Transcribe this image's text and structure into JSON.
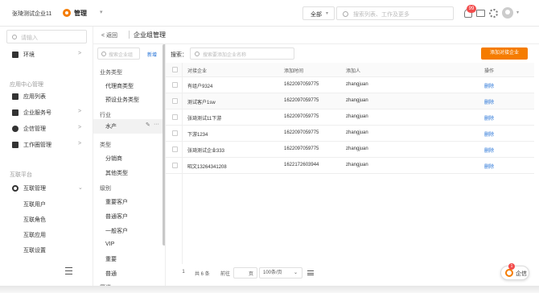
{
  "topbar": {
    "org_name": "张琦测试企业11",
    "module": "管理",
    "module_caret": "▾",
    "scope": "全部",
    "scope_caret": "▾",
    "search_placeholder": "搜索列表、工作及更多",
    "notification_count": "99",
    "avatar_caret": "▾"
  },
  "sidebar": {
    "search_placeholder": "请输入",
    "top_items": [
      {
        "label": "环境",
        "arrow": ">"
      }
    ],
    "section_app": "应用中心管理",
    "app_items": [
      {
        "label": "应用列表",
        "arrow": ""
      },
      {
        "label": "企业服务号",
        "arrow": ">"
      },
      {
        "label": "企信管理",
        "arrow": ">"
      },
      {
        "label": "工作圈管理",
        "arrow": ">"
      }
    ],
    "section_link": "互联平台",
    "link_group": {
      "label": "互联管理",
      "arrow": "⌄"
    },
    "link_subitems": [
      "互联用户",
      "互联角色",
      "互联应用",
      "互联设置"
    ]
  },
  "breadcrumb": {
    "back": "< 返回",
    "title": "企业组管理"
  },
  "category_panel": {
    "search_placeholder": "搜索企业组",
    "new_label": "新增",
    "groups": [
      {
        "title": "业务类型",
        "items": [
          "代理商类型",
          "预设业务类型"
        ]
      },
      {
        "title": "行业",
        "items": [
          "水产"
        ]
      },
      {
        "title": "类型",
        "items": [
          "分销商",
          "其他类型"
        ]
      },
      {
        "title": "级别",
        "items": [
          "重要客户",
          "普通客户",
          "一般客户",
          "VIP",
          "重要",
          "普通"
        ]
      },
      {
        "title": "渠道",
        "items": []
      }
    ],
    "selected": "水产",
    "edit_icon": "✎",
    "more_icon": "···"
  },
  "data_area": {
    "filter_label": "搜索：",
    "filter_placeholder": "搜索要添加企业名称",
    "add_button": "添加对接企业",
    "columns": [
      "对接企业",
      "添加时间",
      "添加人",
      "操作"
    ],
    "rows": [
      {
        "company": "有组户9324",
        "time": "1622097059775",
        "user": "zhangjuan",
        "op": "删除"
      },
      {
        "company": "测试客户1sw",
        "time": "1622097059775",
        "user": "zhangjuan",
        "op": "删除"
      },
      {
        "company": "张琦测试11下游",
        "time": "1622097059775",
        "user": "zhangjuan",
        "op": "删除"
      },
      {
        "company": "下游1234",
        "time": "1622097059775",
        "user": "zhangjuan",
        "op": "删除"
      },
      {
        "company": "张琦测试企业333",
        "time": "1622097059775",
        "user": "zhangjuan",
        "op": "删除"
      },
      {
        "company": "昭文13264341208",
        "time": "1622172603944",
        "user": "zhangjuan",
        "op": "删除"
      }
    ]
  },
  "pager": {
    "current_page": "1",
    "total": "共 6 条",
    "goto_label": "前往",
    "page_unit": "页",
    "page_size": "100条/页",
    "page_size_caret": "⌄"
  },
  "help": {
    "badge": "1",
    "label": "企信"
  },
  "colors": {
    "accent": "#f57c00",
    "link": "#1f6fd6",
    "badge": "#f24c4c"
  }
}
